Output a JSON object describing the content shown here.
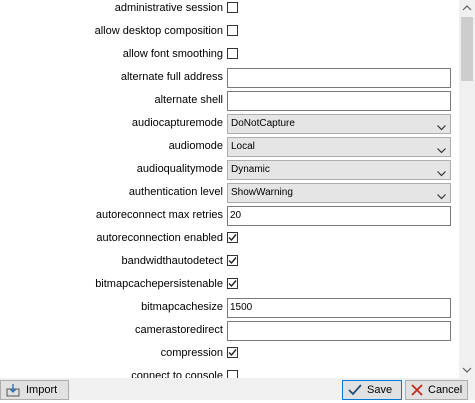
{
  "properties": [
    {
      "label": "administrative session",
      "kind": "checkbox",
      "checked": false
    },
    {
      "label": "allow desktop composition",
      "kind": "checkbox",
      "checked": false
    },
    {
      "label": "allow font smoothing",
      "kind": "checkbox",
      "checked": false
    },
    {
      "label": "alternate full address",
      "kind": "text",
      "value": ""
    },
    {
      "label": "alternate shell",
      "kind": "text",
      "value": ""
    },
    {
      "label": "audiocapturemode",
      "kind": "dropdown",
      "value": "DoNotCapture"
    },
    {
      "label": "audiomode",
      "kind": "dropdown",
      "value": "Local"
    },
    {
      "label": "audioqualitymode",
      "kind": "dropdown",
      "value": "Dynamic"
    },
    {
      "label": "authentication level",
      "kind": "dropdown",
      "value": "ShowWarning"
    },
    {
      "label": "autoreconnect max retries",
      "kind": "text",
      "value": "20"
    },
    {
      "label": "autoreconnection enabled",
      "kind": "checkbox",
      "checked": true
    },
    {
      "label": "bandwidthautodetect",
      "kind": "checkbox",
      "checked": true
    },
    {
      "label": "bitmapcachepersistenable",
      "kind": "checkbox",
      "checked": true
    },
    {
      "label": "bitmapcachesize",
      "kind": "text",
      "value": "1500"
    },
    {
      "label": "camerastoredirect",
      "kind": "text",
      "value": ""
    },
    {
      "label": "compression",
      "kind": "checkbox",
      "checked": true
    },
    {
      "label": "connect to console",
      "kind": "checkbox",
      "checked": false
    }
  ],
  "buttons": {
    "import": "Import",
    "save": "Save",
    "cancel": "Cancel"
  },
  "icons": {
    "import": "import-icon",
    "save": "checkmark-icon",
    "cancel": "close-icon"
  },
  "colors": {
    "accent": "#0078d7",
    "cancel_red": "#c42b1c"
  }
}
